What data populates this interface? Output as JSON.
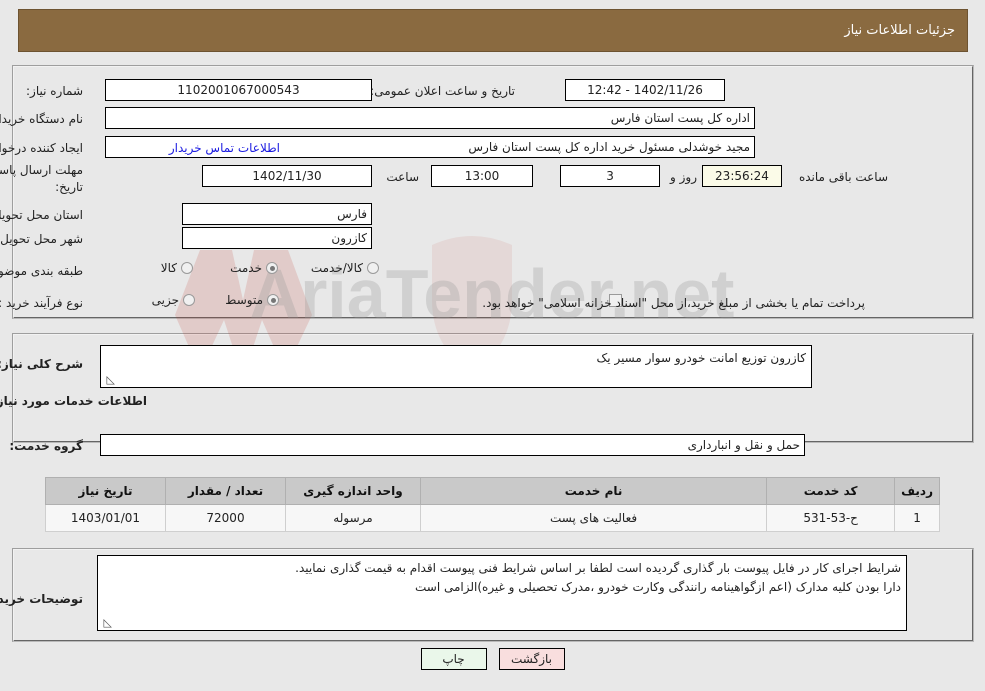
{
  "header": {
    "title": "جزئیات اطلاعات نیاز",
    "bg_color": "#8a6a40",
    "text_color": "#ffffff"
  },
  "form": {
    "need_number_label": "شماره نیاز:",
    "need_number_value": "1102001067000543",
    "announce_datetime_label": "تاریخ و ساعت اعلان عمومی:",
    "announce_datetime_value": "1402/11/26 - 12:42",
    "buyer_org_label": "نام دستگاه خریدار:",
    "buyer_org_value": "اداره کل پست استان فارس",
    "requester_label": "ایجاد کننده درخواست:",
    "requester_value": "مجید خوشدلی مسئول خرید اداره کل پست استان فارس",
    "buyer_contact_link": "اطلاعات تماس خریدار",
    "deadline_label_line1": "مهلت ارسال پاسخ: تا",
    "deadline_label_line2": "تاریخ:",
    "deadline_date_value": "1402/11/30",
    "hour_label": "ساعت",
    "hour_value": "13:00",
    "days_value": "3",
    "days_suffix": "روز و",
    "countdown_value": "23:56:24",
    "countdown_suffix": "ساعت باقی مانده",
    "province_label": "استان محل تحویل:",
    "province_value": "فارس",
    "city_label": "شهر محل تحویل:",
    "city_value": "کازرون",
    "category_label": "طبقه بندی موضوعی:",
    "category_options": [
      {
        "label": "کالا",
        "selected": false
      },
      {
        "label": "خدمت",
        "selected": true
      },
      {
        "label": "کالا/خدمت",
        "selected": false
      }
    ],
    "process_label": "نوع فرآیند خرید :",
    "process_options": [
      {
        "label": "جزیی",
        "selected": false
      },
      {
        "label": "متوسط",
        "selected": true
      }
    ],
    "treasury_checkbox_checked": false,
    "treasury_text": "پرداخت تمام یا بخشی از مبلغ خرید،از محل \"اسناد خزانه اسلامی\" خواهد بود."
  },
  "description": {
    "label": "شرح کلی نیاز:",
    "value": "کازرون توزیع امانت خودرو سوار مسیر یک",
    "resize_handle": "◺"
  },
  "services": {
    "section_title": "اطلاعات خدمات مورد نیاز",
    "group_label": "گروه خدمت:",
    "group_value": "حمل و نقل و انبارداری",
    "table": {
      "columns": [
        "ردیف",
        "کد خدمت",
        "نام خدمت",
        "واحد اندازه گیری",
        "تعداد / مقدار",
        "تاریخ نیاز"
      ],
      "rows": [
        {
          "row_no": "1",
          "service_code": "ح-53-531",
          "service_name": "فعالیت های پست",
          "unit": "مرسوله",
          "quantity": "72000",
          "need_date": "1403/01/01"
        }
      ]
    }
  },
  "buyer_notes": {
    "label": "توضیحات خریدار:",
    "line1": "شرایط اجرای کار در فایل پیوست بار گذاری گردیده است لطفا بر اساس شرایط فنی پیوست اقدام به قیمت گذاری نمایید.",
    "line2": "دارا بودن کلیه مدارک (اعم ازگواهینامه رانندگی وکارت خودرو ،مدرک تحصیلی و غیره)الزامی است",
    "resize_handle": "◺"
  },
  "buttons": {
    "print_label": "چاپ",
    "back_label": "بازگشت",
    "print_color": "#eaf7ea",
    "back_color": "#f9dede"
  },
  "watermark": {
    "text": "AriaTender.net"
  }
}
